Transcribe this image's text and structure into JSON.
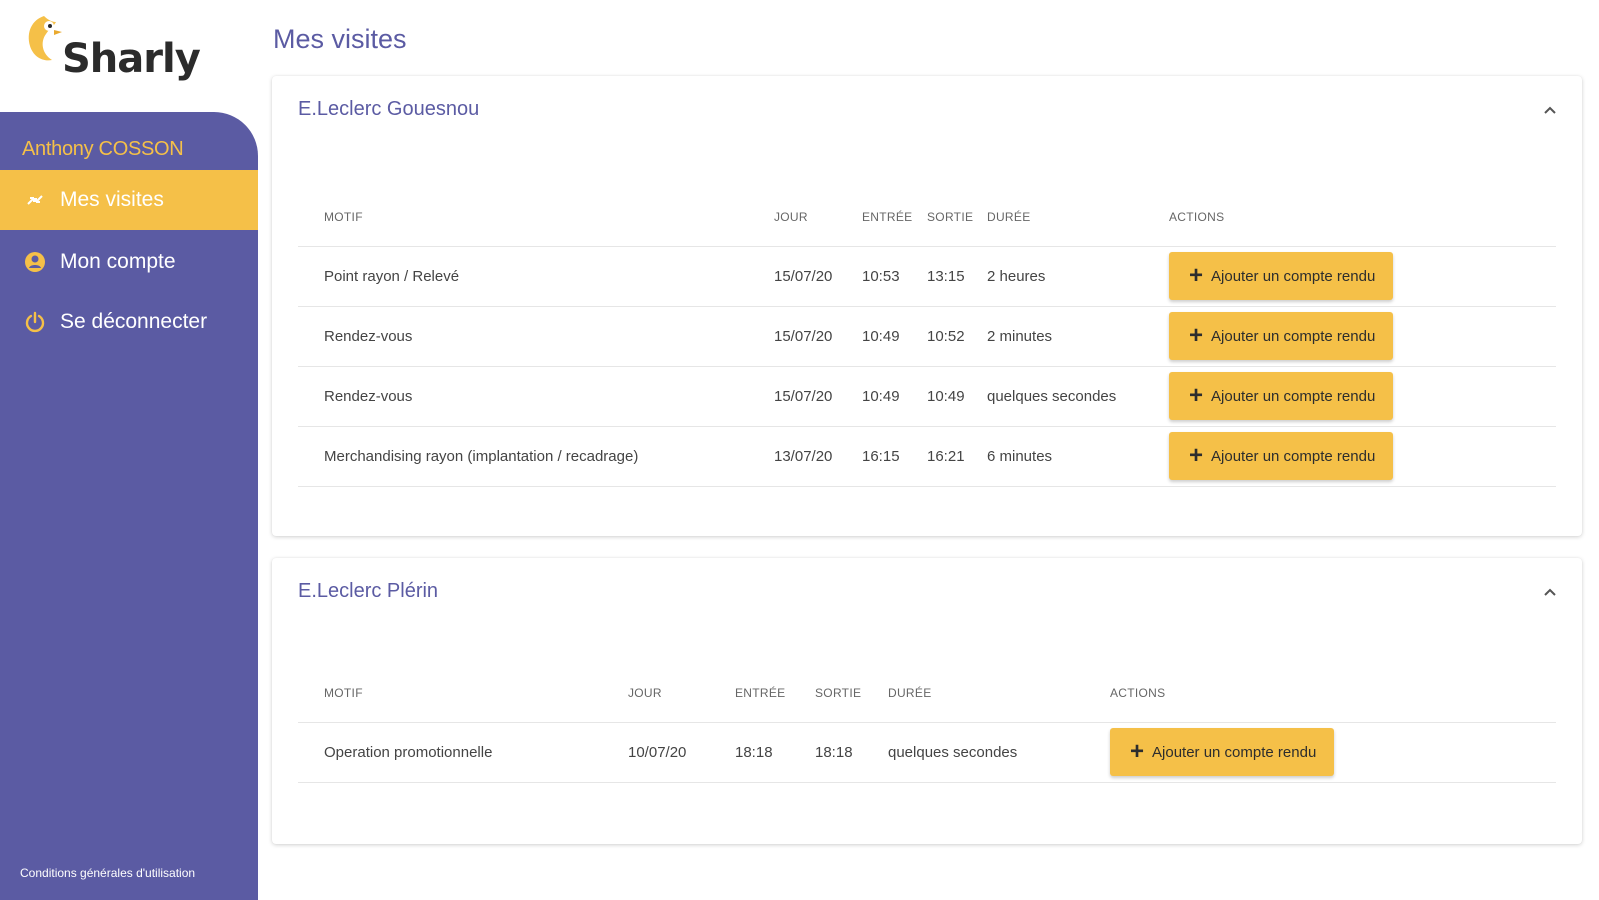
{
  "brand": {
    "name": "Sharly",
    "accent": "#f5c048",
    "primary": "#5b5ba3"
  },
  "sidebar": {
    "user_name": "Anthony COSSON",
    "items": [
      {
        "label": "Mes visites",
        "icon": "swap-icon",
        "active": true
      },
      {
        "label": "Mon compte",
        "icon": "account-icon",
        "active": false
      },
      {
        "label": "Se déconnecter",
        "icon": "power-icon",
        "active": false
      }
    ],
    "footer_link": "Conditions générales d'utilisation"
  },
  "page": {
    "title": "Mes visites"
  },
  "columns": [
    "Motif",
    "Jour",
    "Entrée",
    "Sortie",
    "Durée",
    "Actions"
  ],
  "stores": [
    {
      "name": "E.Leclerc Gouesnou",
      "rows": [
        {
          "motif": "Point rayon / Relevé",
          "jour": "15/07/20",
          "entree": "10:53",
          "sortie": "13:15",
          "duree": "2 heures"
        },
        {
          "motif": "Rendez-vous",
          "jour": "15/07/20",
          "entree": "10:49",
          "sortie": "10:52",
          "duree": "2 minutes"
        },
        {
          "motif": "Rendez-vous",
          "jour": "15/07/20",
          "entree": "10:49",
          "sortie": "10:49",
          "duree": "quelques secondes"
        },
        {
          "motif": "Merchandising rayon (implantation / recadrage)",
          "jour": "13/07/20",
          "entree": "16:15",
          "sortie": "16:21",
          "duree": "6 minutes"
        }
      ]
    },
    {
      "name": "E.Leclerc Plérin",
      "rows": [
        {
          "motif": "Operation promotionnelle",
          "jour": "10/07/20",
          "entree": "18:18",
          "sortie": "18:18",
          "duree": "quelques secondes"
        }
      ]
    }
  ],
  "actions": {
    "add_report_label": "Ajouter un compte rendu",
    "add_icon": "plus-icon"
  }
}
